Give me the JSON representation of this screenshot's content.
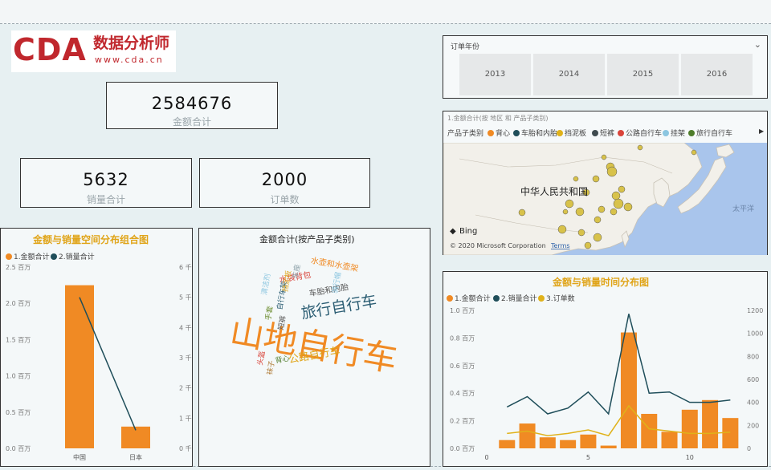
{
  "logo": {
    "brand": "CDA",
    "chinese": "数据分析师",
    "url": "www.cda.cn"
  },
  "kpis": {
    "amount": {
      "value": "2584676",
      "label": "金额合计"
    },
    "quantity": {
      "value": "5632",
      "label": "销量合计"
    },
    "orders": {
      "value": "2000",
      "label": "订单数"
    }
  },
  "slicer": {
    "title": "订单年份",
    "years": [
      "2013",
      "2014",
      "2015",
      "2016"
    ]
  },
  "map": {
    "title": "1.金额合计(按 地区 和 产品子类别)",
    "legend_title": "产品子类别",
    "legend": [
      {
        "name": "背心",
        "color": "#f08a24"
      },
      {
        "name": "车胎和内胎",
        "color": "#1f4e5a"
      },
      {
        "name": "挡泥板",
        "color": "#e0b21a"
      },
      {
        "name": "短裤",
        "color": "#3f4b4f"
      },
      {
        "name": "公路自行车",
        "color": "#d9443a"
      },
      {
        "name": "挂架",
        "color": "#8cc6e0"
      },
      {
        "name": "旅行自行车",
        "color": "#4f7d2b"
      }
    ],
    "country_label": "中华人民共和国",
    "ocean_label": "太平洋",
    "bing": "Bing",
    "copyright": "© 2020 Microsoft Corporation",
    "terms": "Terms"
  },
  "colors": {
    "orange": "#f08a24",
    "navy": "#1f4e5a",
    "gold": "#e0b21a",
    "title": "#e0a418"
  },
  "charts": {
    "space": {
      "title": "金额与销量空间分布组合图",
      "legend": [
        "1.金额合计",
        "2.销量合计"
      ],
      "left_ticks": [
        "2.5 百万",
        "2.0 百万",
        "1.5 百万",
        "1.0 百万",
        "0.5 百万",
        "0.0 百万"
      ],
      "right_ticks": [
        "6 千",
        "5 千",
        "4 千",
        "3 千",
        "2 千",
        "1 千",
        "0 千"
      ]
    },
    "cloud": {
      "title": "金额合计(按产品子类别)"
    },
    "time": {
      "title": "金额与销量时间分布图",
      "legend": [
        "1.金额合计",
        "2.销量合计",
        "3.订单数"
      ],
      "left_ticks": [
        "1.0 百万",
        "0.8 百万",
        "0.6 百万",
        "0.4 百万",
        "0.2 百万",
        "0.0 百万"
      ],
      "right_ticks": [
        "1200",
        "1000",
        "800",
        "600",
        "400",
        "200",
        "0"
      ],
      "x_ticks": [
        "0",
        "5",
        "10"
      ]
    }
  },
  "chart_data": [
    {
      "type": "bar",
      "title": "金额与销量空间分布组合图",
      "categories": [
        "中国",
        "日本"
      ],
      "series": [
        {
          "name": "1.金额合计",
          "values": [
            2.25,
            0.3
          ],
          "unit": "百万"
        },
        {
          "name": "2.销量合计",
          "values": [
            5.0,
            0.6
          ],
          "unit": "千",
          "axis": "right",
          "render": "line"
        }
      ],
      "ylim": [
        0,
        2.5
      ],
      "y2lim": [
        0,
        6
      ]
    },
    {
      "type": "wordcloud",
      "title": "金额合计(按产品子类别)",
      "words": [
        {
          "text": "山地自行车",
          "size": 42,
          "color": "#f08a24",
          "rotate": 10
        },
        {
          "text": "旅行自行车",
          "size": 19,
          "color": "#2b5d73",
          "rotate": -10
        },
        {
          "text": "公路自行车",
          "size": 13,
          "color": "#e0a418",
          "rotate": -10
        },
        {
          "text": "水壶和水壶架",
          "size": 10,
          "color": "#f08a24",
          "rotate": 10
        },
        {
          "text": "车胎和内胎",
          "size": 10,
          "color": "#555",
          "rotate": -10
        },
        {
          "text": "水袋背包",
          "size": 10,
          "color": "#d9443a",
          "rotate": -10
        },
        {
          "text": "骑行帽",
          "size": 9,
          "color": "#8cc6e0",
          "rotate": -80
        },
        {
          "text": "自行车架",
          "size": 9,
          "color": "#2b5d73",
          "rotate": -80
        },
        {
          "text": "清洁剂",
          "size": 9,
          "color": "#8cc6e0",
          "rotate": -80
        },
        {
          "text": "挡泥板",
          "size": 9,
          "color": "#e0a418",
          "rotate": -80
        },
        {
          "text": "车座",
          "size": 9,
          "color": "#8ba0a8",
          "rotate": -80
        },
        {
          "text": "短裤",
          "size": 9,
          "color": "#555",
          "rotate": -80
        },
        {
          "text": "头盔",
          "size": 9,
          "color": "#d9443a",
          "rotate": -80
        },
        {
          "text": "袜子",
          "size": 9,
          "color": "#b07d3a",
          "rotate": -80
        },
        {
          "text": "背心",
          "size": 9,
          "color": "#4f7d2b",
          "rotate": -10
        },
        {
          "text": "手套",
          "size": 9,
          "color": "#6b8c2e",
          "rotate": -80
        }
      ]
    },
    {
      "type": "bar",
      "title": "金额与销量时间分布图",
      "x": [
        1,
        2,
        3,
        4,
        5,
        6,
        7,
        8,
        9,
        10,
        11,
        12
      ],
      "series": [
        {
          "name": "1.金额合计",
          "values": [
            0.06,
            0.18,
            0.08,
            0.06,
            0.1,
            0.02,
            0.84,
            0.25,
            0.12,
            0.28,
            0.35,
            0.22
          ],
          "unit": "百万"
        },
        {
          "name": "2.销量合计",
          "values": [
            360,
            450,
            300,
            350,
            490,
            300,
            1170,
            480,
            490,
            400,
            400,
            420
          ],
          "axis": "right",
          "render": "line"
        },
        {
          "name": "3.订单数",
          "values": [
            130,
            150,
            110,
            130,
            160,
            110,
            370,
            170,
            150,
            130,
            130,
            140
          ],
          "axis": "right",
          "render": "line"
        }
      ],
      "xlim": [
        0,
        12.5
      ],
      "ylim": [
        0,
        1.0
      ],
      "y2lim": [
        0,
        1200
      ]
    }
  ]
}
